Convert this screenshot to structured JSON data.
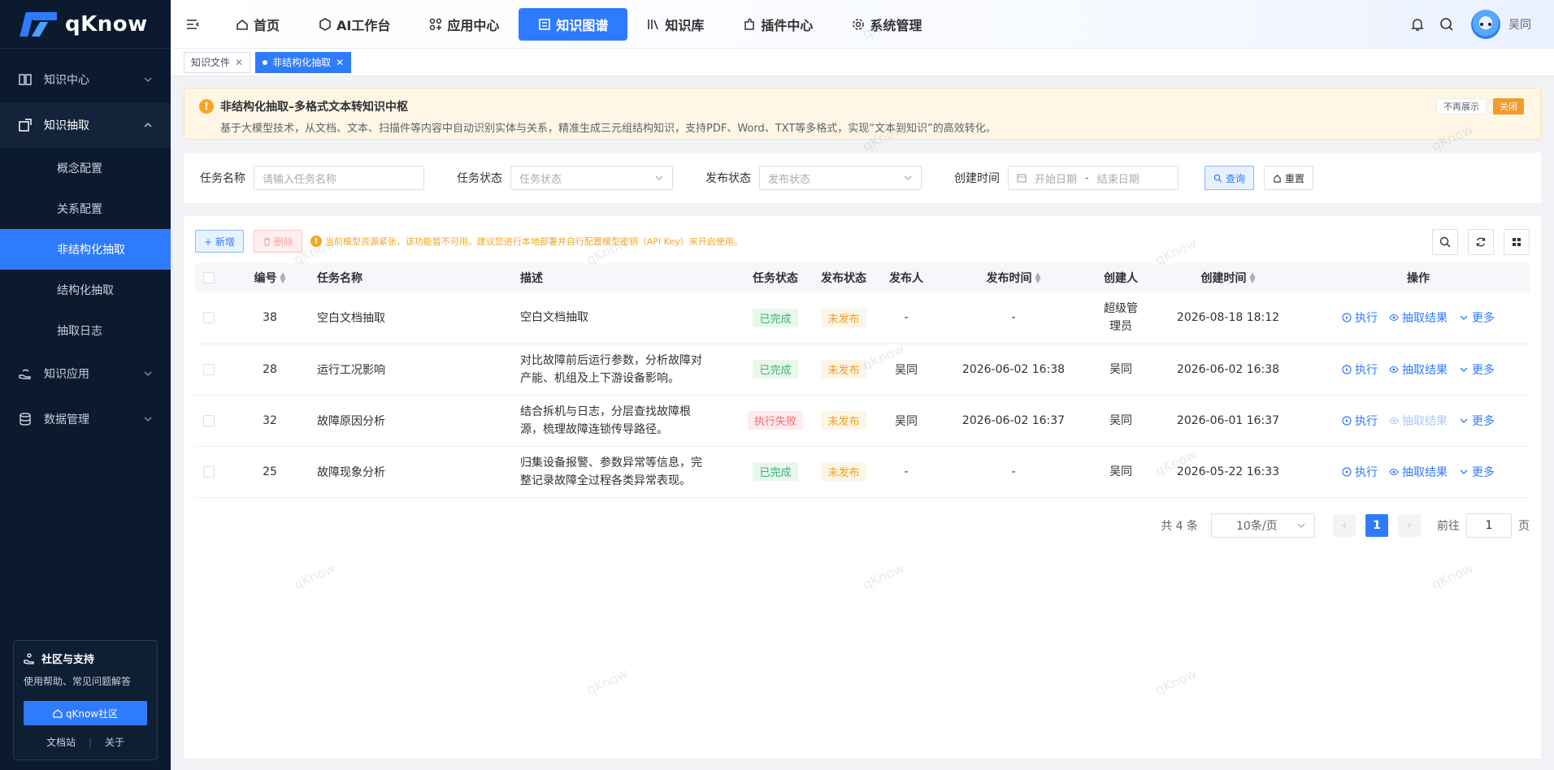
{
  "app": {
    "name": "qKnow"
  },
  "sidebar": {
    "items": [
      {
        "label": "知识中心",
        "icon": "book-icon"
      },
      {
        "label": "知识抽取",
        "icon": "extract-icon"
      },
      {
        "label": "知识应用",
        "icon": "hand-icon"
      },
      {
        "label": "数据管理",
        "icon": "database-icon"
      }
    ],
    "sub_items": [
      "概念配置",
      "关系配置",
      "非结构化抽取",
      "结构化抽取",
      "抽取日志"
    ],
    "community": {
      "title": "社区与支持",
      "desc": "使用帮助、常见问题解答",
      "button": "qKnow社区",
      "link_docs": "文档站",
      "link_about": "关于"
    }
  },
  "topnav": {
    "items": [
      "首页",
      "AI工作台",
      "应用中心",
      "知识图谱",
      "知识库",
      "插件中心",
      "系统管理"
    ],
    "active": "知识图谱",
    "user": "吴同"
  },
  "tags": [
    {
      "label": "知识文件"
    },
    {
      "label": "非结构化抽取",
      "active": true
    }
  ],
  "notice": {
    "title": "非结构化抽取–多格式文本转知识中枢",
    "desc": "基于大模型技术，从文档、文本、扫描件等内容中自动识别实体与关系，精准生成三元组结构知识，支持PDF、Word、TXT等多格式，实现“文本到知识”的高效转化。",
    "dismiss": "不再展示",
    "close": "关闭"
  },
  "filter": {
    "task_name_label": "任务名称",
    "task_name_placeholder": "请输入任务名称",
    "task_status_label": "任务状态",
    "task_status_placeholder": "任务状态",
    "publish_status_label": "发布状态",
    "publish_status_placeholder": "发布状态",
    "created_label": "创建时间",
    "start_placeholder": "开始日期",
    "range_sep": "-",
    "end_placeholder": "结束日期",
    "query": "查询",
    "reset": "重置"
  },
  "toolbar": {
    "add": "+ 新增",
    "delete": "删除",
    "warning": "当前模型资源紧张，该功能暂不可用。建议您进行本地部署并自行配置模型密钥（API Key）来开启使用。"
  },
  "table": {
    "headers": [
      "编号",
      "任务名称",
      "描述",
      "任务状态",
      "发布状态",
      "发布人",
      "发布时间",
      "创建人",
      "创建时间",
      "操作"
    ],
    "rows": [
      {
        "id": "38",
        "name": "空白文档抽取",
        "desc": "空白文档抽取",
        "status": "已完成",
        "status_type": "done",
        "publish": "未发布",
        "publisher": "-",
        "publish_time": "-",
        "creator": "超级管理员",
        "created": "2026-08-18 18:12",
        "extract_disabled": false
      },
      {
        "id": "28",
        "name": "运行工况影响",
        "desc": "对比故障前后运行参数，分析故障对产能、机组及上下游设备影响。",
        "status": "已完成",
        "status_type": "done",
        "publish": "未发布",
        "publisher": "吴同",
        "publish_time": "2026-06-02 16:38",
        "creator": "吴同",
        "created": "2026-06-02 16:38",
        "extract_disabled": false
      },
      {
        "id": "32",
        "name": "故障原因分析",
        "desc": "结合拆机与日志，分层查找故障根源，梳理故障连锁传导路径。",
        "status": "执行失败",
        "status_type": "fail",
        "publish": "未发布",
        "publisher": "吴同",
        "publish_time": "2026-06-02 16:37",
        "creator": "吴同",
        "created": "2026-06-01 16:37",
        "extract_disabled": true
      },
      {
        "id": "25",
        "name": "故障现象分析",
        "desc": "归集设备报警、参数异常等信息，完整记录故障全过程各类异常表现。",
        "status": "已完成",
        "status_type": "done",
        "publish": "未发布",
        "publisher": "-",
        "publish_time": "-",
        "creator": "吴同",
        "created": "2026-05-22 16:33",
        "extract_disabled": false
      }
    ],
    "ops": {
      "run": "执行",
      "result": "抽取结果",
      "more": "更多"
    }
  },
  "pagination": {
    "total": "共 4 条",
    "page_size": "10条/页",
    "current": "1",
    "goto_label": "前往",
    "goto_value": "1",
    "page_suffix": "页"
  },
  "watermark": "qKnow",
  "colors": {
    "primary": "#2f7bff",
    "sidebar_bg": "#0b1a2e",
    "success": "#3cb371",
    "danger": "#f56c6c",
    "warning": "#f0a020"
  }
}
